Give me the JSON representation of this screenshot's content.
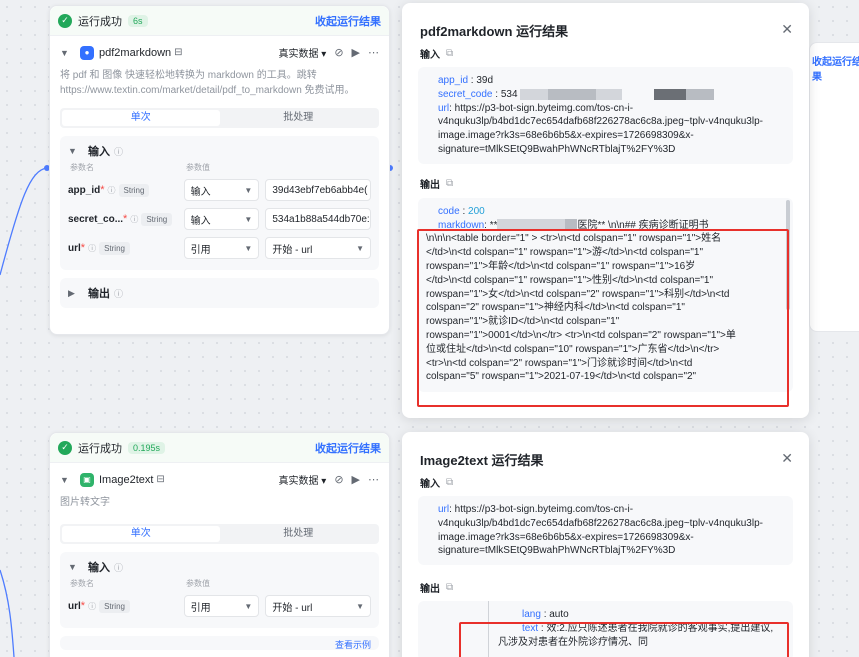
{
  "node1": {
    "status": "运行成功",
    "time": "6s",
    "collapse": "收起运行结果",
    "title": "pdf2markdown",
    "data_select": "真实数据",
    "desc_line1": "将 pdf 和 图像 快速轻松地转换为 markdown 的工具。跳转",
    "desc_line2": "https://www.textin.com/market/detail/pdf_to_markdown 免费试用。",
    "tabs": [
      "单次",
      "批处理"
    ],
    "input_label": "输入",
    "col_name": "参数名",
    "col_value": "参数值",
    "params": [
      {
        "name": "app_id",
        "type": "String",
        "mode": "输入",
        "value": "39d43ebf7eb6abb4e("
      },
      {
        "name": "secret_co...",
        "type": "String",
        "mode": "输入",
        "value": "534a1b88a544db70e:"
      },
      {
        "name": "url",
        "type": "String",
        "mode": "引用",
        "value": "开始 - url"
      }
    ],
    "output_label": "输出"
  },
  "node2": {
    "status": "运行成功",
    "time": "0.195s",
    "collapse": "收起运行结果",
    "title": "Image2text",
    "data_select": "真实数据",
    "desc": "图片转文字",
    "tabs": [
      "单次",
      "批处理"
    ],
    "input_label": "输入",
    "col_name": "参数名",
    "col_value": "参数值",
    "params": [
      {
        "name": "url",
        "type": "String",
        "mode": "引用",
        "value": "开始 - url"
      }
    ],
    "output_label": "输出",
    "bottom_link": "查看示例"
  },
  "panel1": {
    "title": "pdf2markdown 运行结果",
    "input_label": "输入",
    "output_label": "输出",
    "app_id_key": "app_id",
    "app_id_val": "39d",
    "secret_key": "secret_code",
    "secret_val": "534",
    "url_key": "url",
    "url_lines": [
      ": https://p3-bot-sign.byteimg.com/tos-cn-i-",
      "v4nquku3lp/b4bd1dc7ec654dafb68f226278ac6c8a.jpeg~tplv-v4nquku3lp-",
      "image.image?rk3s=68e6b6b5&x-expires=1726698309&x-",
      "signature=tMlkSEtQ9BwahPhWNcRTblajT%2FY%3D"
    ],
    "code_key": "code",
    "code_val": "200",
    "markdown_key": "markdown",
    "markdown_first": ": **",
    "markdown_first_b": "医院** \\n\\n## 疾病诊断证明书",
    "markdown_lines": [
      "\\n\\n\\n<table border=\"1\" > <tr>\\n<td colspan=\"1\" rowspan=\"1\">姓名",
      "</td>\\n<td colspan=\"1\" rowspan=\"1\">游</td>\\n<td colspan=\"1\"",
      "rowspan=\"1\">年龄</td>\\n<td colspan=\"1\" rowspan=\"1\">16岁",
      "</td>\\n<td colspan=\"1\" rowspan=\"1\">性别</td>\\n<td colspan=\"1\"",
      "rowspan=\"1\">女</td>\\n<td colspan=\"2\" rowspan=\"1\">科别</td>\\n<td",
      "colspan=\"2\" rowspan=\"1\">神经内科</td>\\n<td colspan=\"1\"",
      "rowspan=\"1\">就诊ID</td>\\n<td colspan=\"1\"",
      "rowspan=\"1\">0001</td>\\n</tr> <tr>\\n<td colspan=\"2\" rowspan=\"1\">单",
      "位或住址</td>\\n<td colspan=\"10\" rowspan=\"1\">广东省</td>\\n</tr>",
      "<tr>\\n<td colspan=\"2\" rowspan=\"1\">门诊就诊时间</td>\\n<td",
      "colspan=\"5\" rowspan=\"1\">2021-07-19</td>\\n<td colspan=\"2\""
    ]
  },
  "panel2": {
    "title": "Image2text 运行结果",
    "input_label": "输入",
    "output_label": "输出",
    "url_key": "url",
    "url_lines": [
      ": https://p3-bot-sign.byteimg.com/tos-cn-i-",
      "v4nquku3lp/b4bd1dc7ec654dafb68f226278ac6c8a.jpeg~tplv-v4nquku3lp-",
      "image.image?rk3s=68e6b6b5&x-expires=1726698309&x-",
      "signature=tMlkSEtQ9BwahPhWNcRTblajT%2FY%3D"
    ],
    "lang_key": "lang",
    "lang_val": ": auto",
    "text_key": "text",
    "text_line1": ": 效:2.应只陈述患者在我院就诊的客观事实,提出建议,",
    "text_line2": "凡涉及对患者在外院诊疗情况、同"
  },
  "side": {
    "collapse": "收起运行结果"
  }
}
